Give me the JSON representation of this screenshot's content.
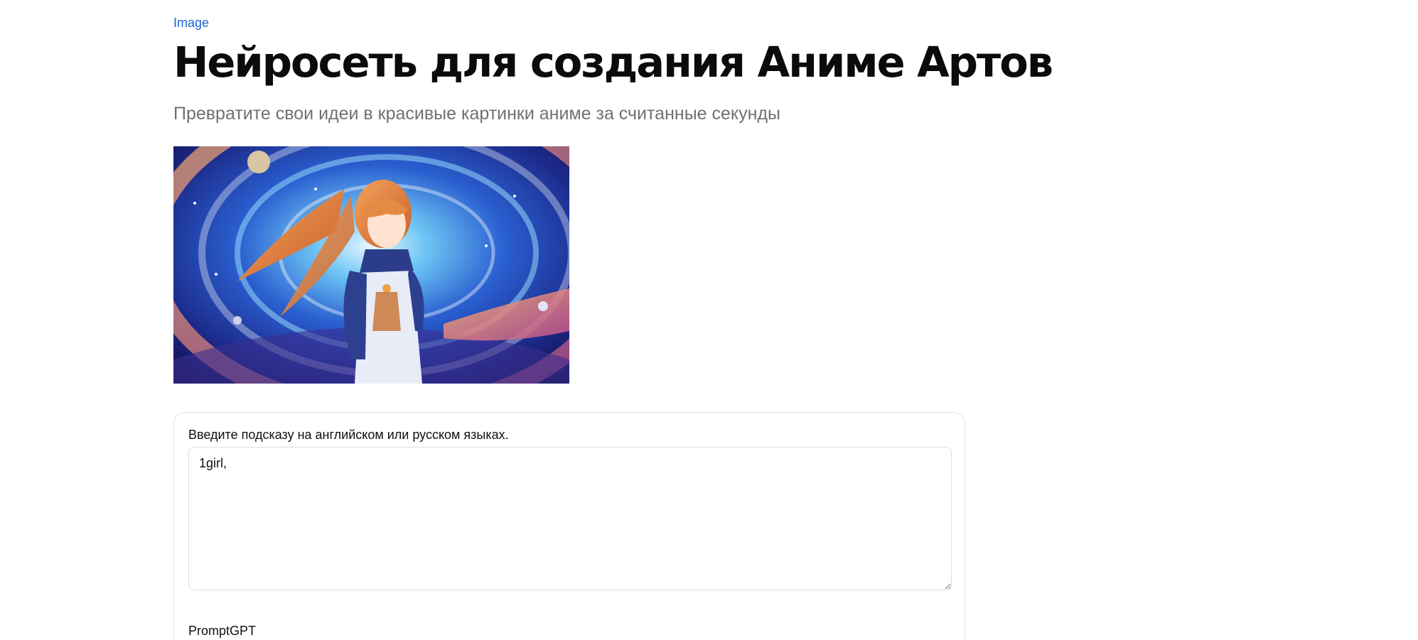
{
  "breadcrumb": {
    "category": "Image"
  },
  "header": {
    "title": "Нейросеть для создания Аниме Артов",
    "subtitle": "Превратите свои идеи в красивые картинки аниме за считанные секунды"
  },
  "form": {
    "prompt_label": "Введите подсказу на английском или русском языках.",
    "prompt_value": "1girl,",
    "promptgpt_label": "PromptGPT"
  },
  "colors": {
    "link": "#1a66d6",
    "title": "#0b0b0b",
    "subtitle": "#707070",
    "border": "#e3e3e3"
  }
}
